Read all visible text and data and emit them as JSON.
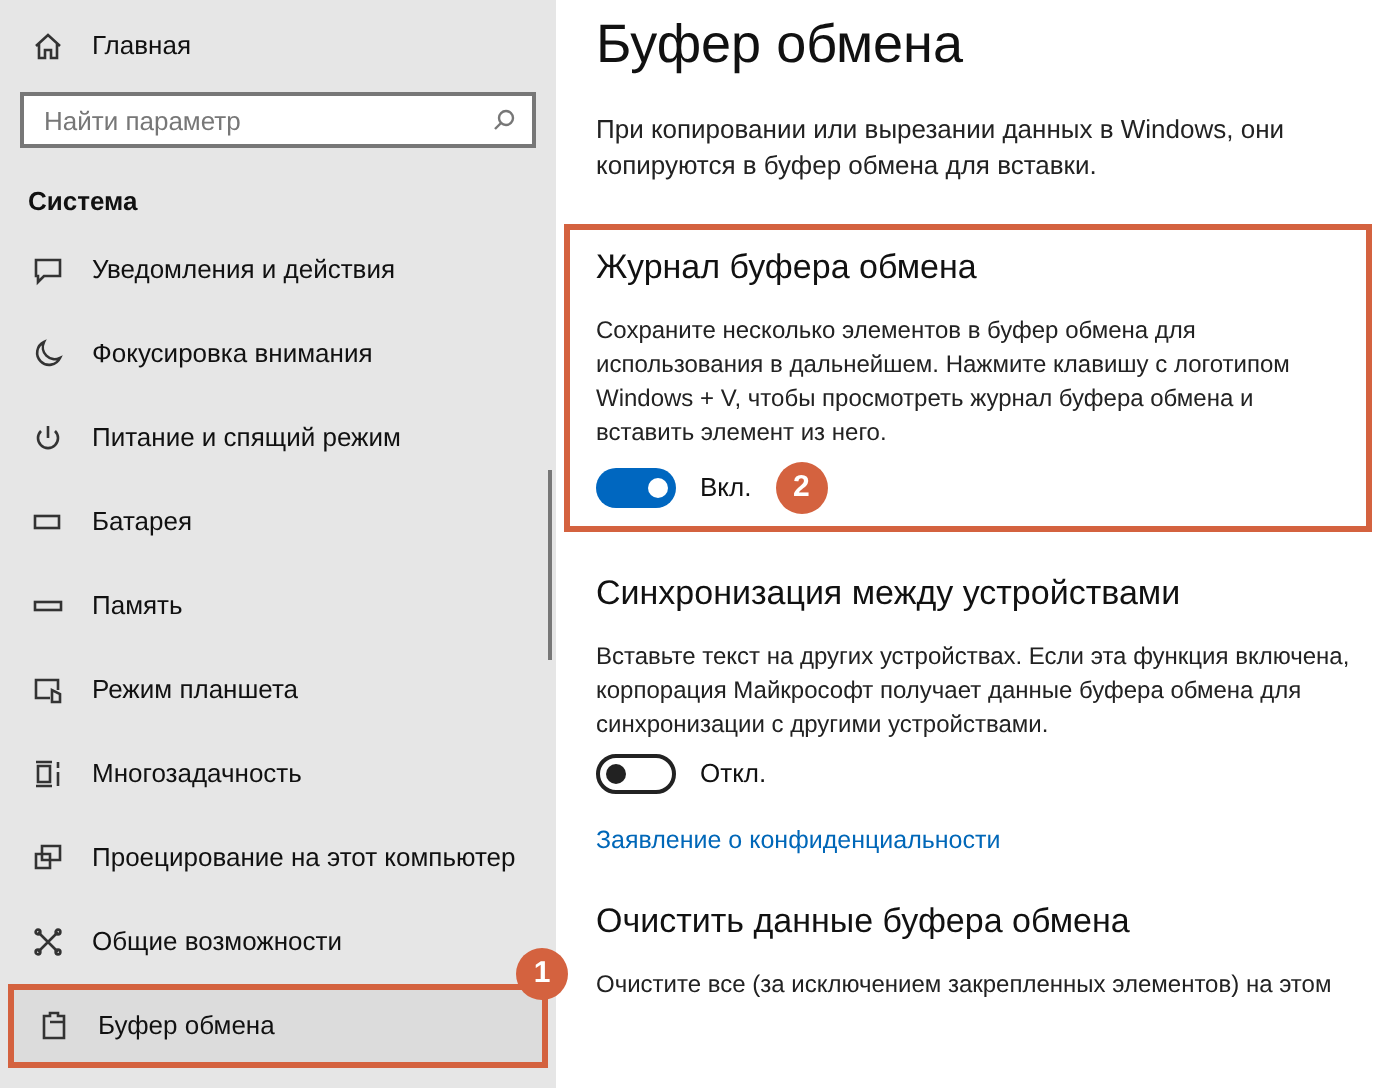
{
  "sidebar": {
    "home": "Главная",
    "search": {
      "placeholder": "Найти параметр"
    },
    "section": "Система",
    "items": [
      {
        "label": "Уведомления и действия",
        "selected": false
      },
      {
        "label": "Фокусировка внимания",
        "selected": false
      },
      {
        "label": "Питание и спящий режим",
        "selected": false
      },
      {
        "label": "Батарея",
        "selected": false
      },
      {
        "label": "Память",
        "selected": false
      },
      {
        "label": "Режим планшета",
        "selected": false
      },
      {
        "label": "Многозадачность",
        "selected": false
      },
      {
        "label": "Проецирование на этот компьютер",
        "selected": false
      },
      {
        "label": "Общие возможности",
        "selected": false
      },
      {
        "label": "Буфер обмена",
        "selected": true,
        "callout": "1"
      }
    ]
  },
  "page": {
    "title": "Буфер обмена",
    "intro": "При копировании или вырезании данных в Windows, они копируются в буфер обмена для вставки.",
    "sections": [
      {
        "title": "Журнал буфера обмена",
        "text": "Сохраните несколько элементов в буфер обмена для использования в дальнейшем. Нажмите клавишу с логотипом Windows + V, чтобы просмотреть журнал буфера обмена и вставить элемент из него.",
        "toggle": {
          "on": true,
          "label": "Вкл."
        },
        "callout": "2"
      },
      {
        "title": "Синхронизация между устройствами",
        "text": "Вставьте текст на других устройствах. Если эта функция включена, корпорация Майкрософт получает данные буфера обмена для синхронизации с другими устройствами.",
        "toggle": {
          "on": false,
          "label": "Откл."
        },
        "link": "Заявление о конфиденциальности"
      },
      {
        "title": "Очистить данные буфера обмена",
        "text": "Очистите все (за исключением закрепленных элементов) на этом"
      }
    ]
  }
}
